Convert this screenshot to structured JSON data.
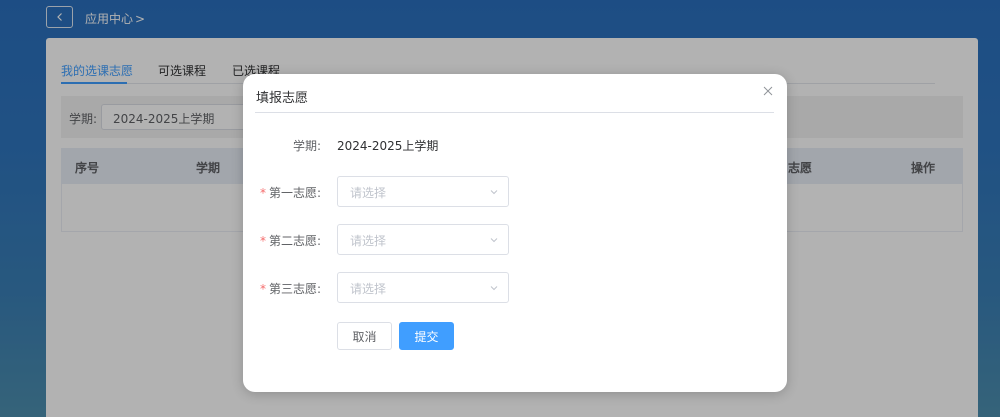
{
  "topbar": {
    "breadcrumb": "应用中心",
    "breadcrumb_sep": ">"
  },
  "tabs": [
    {
      "label": "我的选课志愿"
    },
    {
      "label": "可选课程"
    },
    {
      "label": "已选课程"
    }
  ],
  "filter": {
    "label": "学期:",
    "value": "2024-2025上学期"
  },
  "table": {
    "headers": [
      "序号",
      "学期",
      "志愿",
      "操作"
    ]
  },
  "dialog": {
    "title": "填报志愿",
    "semester_label": "学期:",
    "semester_value": "2024-2025上学期",
    "required_mark": "*",
    "choice1_label": "第一志愿:",
    "choice2_label": "第二志愿:",
    "choice3_label": "第三志愿:",
    "select_placeholder": "请选择",
    "cancel_label": "取消",
    "submit_label": "提交"
  },
  "colors": {
    "primary": "#409eff",
    "required": "#f56c6c",
    "background_top": "#2a6fbd"
  }
}
